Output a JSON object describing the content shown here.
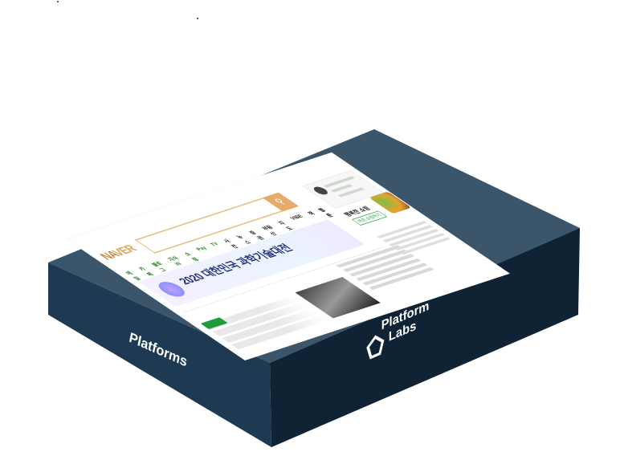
{
  "labels": {
    "left_face": "Platforms",
    "brand_line1": "Platform",
    "brand_line2": "Labs"
  },
  "screen": {
    "logo_part1": "NA",
    "logo_part2": "VER",
    "search_placeholder": "",
    "search_icon": "search-icon",
    "nav": [
      "메일",
      "카페",
      "블로그",
      "지식iN",
      "쇼핑",
      "Pay",
      "TV",
      "사전",
      "뉴스",
      "증권",
      "부동산",
      "지도",
      "VIBE",
      "책",
      "웹툰"
    ],
    "banner_title": "2020 대한민국 과학기술대전",
    "banner_subtitle": "",
    "shop_title": "행복한 쇼핑",
    "shop_badge": "바로 쇼핑하기"
  },
  "colors": {
    "box_top": "#345064",
    "box_front_left": "#243f55",
    "box_front_right": "#0e2236",
    "page_bg": "#ffffff",
    "accent_green": "#1e9b3a",
    "accent_orange": "#e8aa6a"
  }
}
